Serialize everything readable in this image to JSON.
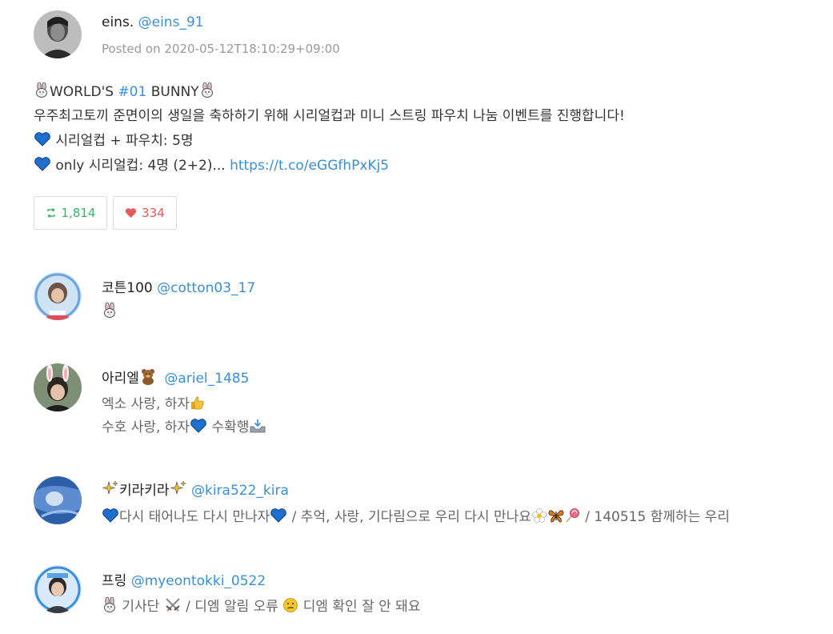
{
  "post": {
    "display_name": "eins.",
    "handle": "@eins_91",
    "posted_label": "Posted on 2020-05-12T18:10:29+09:00",
    "line1_a": "WORLD'S ",
    "line1_hashtag": "#01",
    "line1_b": " BUNNY",
    "line2": "우주최고토끼 준면이의 생일을 축하하기 위해 시리얼컵과 미니 스트링 파우치 나눔 이벤트를 진행합니다!",
    "line3": " 시리얼컵 + 파우치: 5명",
    "line4": " only 시리얼컵: 4명 (2+2)... ",
    "line4_link": "https://t.co/eGGfhPxKj5",
    "retweet_count": "1,814",
    "like_count": "334"
  },
  "replies": [
    {
      "name": "코튼100",
      "handle": "@cotton03_17",
      "lines": [
        ""
      ]
    },
    {
      "name": "아리엘",
      "handle": "@ariel_1485",
      "line1": "엑소 사랑, 하자",
      "line2": "수호 사랑, 하자",
      "line2b": " 수확행"
    },
    {
      "name": "키라키라",
      "handle": "@kira522_kira",
      "line1a": "다시 태어나도 다시 만나자",
      "line1b": " / 추억, 사랑, 기다림으로 우리 다시 만나요",
      "line1c": " / 140515 함께하는 우리"
    },
    {
      "name": "프링",
      "handle": "@myeontokki_0522",
      "line1a": " 기사단 ",
      "line1b": " / 디엠 알림 오류 ",
      "line1c": " 디엠 확인 잘 안 돼요"
    }
  ],
  "icons": {
    "retweet": "retweet-icon",
    "heart": "heart-icon",
    "rabbit": "rabbit-emoji",
    "blue_heart": "blue-heart-emoji",
    "sparkles": "sparkles-emoji",
    "bear": "bear-emoji",
    "thumbs_up": "thumbs-up-emoji",
    "inbox_tray": "inbox-tray-emoji",
    "blossom": "blossom-emoji",
    "butterfly": "butterfly-emoji",
    "lollipop": "lollipop-emoji",
    "crossed_swords": "crossed-swords-emoji",
    "confused_face": "confused-face-emoji"
  },
  "colors": {
    "link": "#3a8fd8",
    "retweet": "#3eb06a",
    "like": "#e35b5b",
    "meta": "#9a9a9a"
  }
}
